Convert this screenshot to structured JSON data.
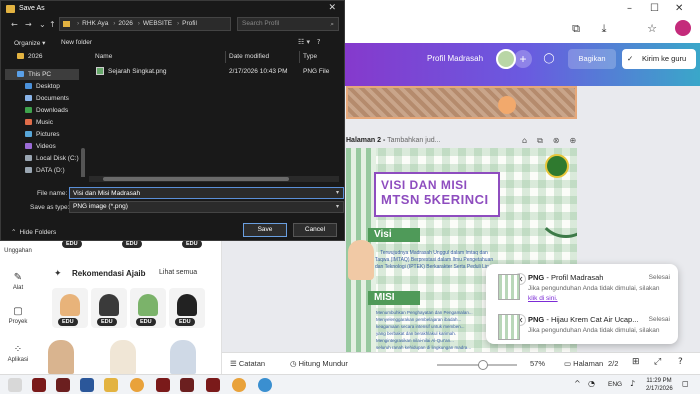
{
  "dialog": {
    "title": "Save As",
    "address": [
      "RHK Aya",
      "2026",
      "WEBSITE",
      "Profil"
    ],
    "search_placeholder": "Search Profil",
    "organize": "Organize ▾",
    "new_folder": "New folder",
    "nav_items": [
      "2026",
      "This PC",
      "Desktop",
      "Documents",
      "Downloads",
      "Music",
      "Pictures",
      "Videos",
      "Local Disk (C:)",
      "DATA (D:)"
    ],
    "columns": {
      "name": "Name",
      "date": "Date modified",
      "type": "Type"
    },
    "files": [
      {
        "name": "Sejarah Singkat.png",
        "date": "2/17/2026 10:43 PM",
        "type": "PNG File"
      }
    ],
    "file_name_label": "File name:",
    "file_name_value": "Visi dan Misi Madrasah",
    "save_type_label": "Save as type:",
    "save_type_value": "PNG image (*.png)",
    "hide_folders": "Hide Folders",
    "save": "Save",
    "cancel": "Cancel"
  },
  "canva": {
    "project_title": "Profil Madrasah",
    "share": "Bagikan",
    "send": "Kirim ke guru",
    "page2_label": "Halaman 2 -",
    "page2_hint": "Tambahkan jud...",
    "design": {
      "title_line1": "VISI DAN MISI",
      "title_line2": "MTSN 5KERINCI",
      "visi_heading": "Visi",
      "visi_text": "Terwujudnya Madrasah Unggul dalam Imtaq dan Taqwa (IMTAQ) Berprestasi dalam Ilmu Pengetahuan dan Teknologi (IPTEK) Berkarakter Serta Peduli Lin...",
      "misi_heading": "MISI",
      "misi_lines": [
        "Menumbuhkan Penghayatan dan Pengamalan...",
        "Menyelenggarakan pembelajaran ibadah...",
        "keagamaan secara intensif untuk memben...",
        "yang berbakat dan berakhlakul karimah.",
        "Mengintegrasikan nilai-nilai Al-Qur'an...",
        "seluruh ranah kehidupan di lingkungan madra..."
      ]
    },
    "bottom": {
      "notes": "Catatan",
      "timer": "Hitung Mundur",
      "zoom": "57%",
      "zoom_level": 0.57,
      "pages": "Halaman",
      "page_count": "2/2"
    },
    "rail": [
      "Unggahan",
      "Alat",
      "Proyek",
      "Aplikasi"
    ],
    "panel": {
      "edu": "EDU",
      "rec_title": "Rekomendasi Ajaib",
      "see_all": "Lihat semua"
    }
  },
  "notifications": [
    {
      "file": "PNG",
      "name": "- Profil Madrasah",
      "status": "Selesai",
      "body": "Jika pengunduhan Anda tidak dimulai, silakan",
      "link": "klik di sini."
    },
    {
      "file": "PNG",
      "name": "- Hijau Krem Cat Air Ucap...",
      "status": "Selesai",
      "body": "Jika pengunduhan Anda tidak dimulai, silakan"
    }
  ],
  "taskbar": {
    "lang": "ENG",
    "time": "11:29 PM",
    "date": "2/17/2026"
  },
  "colors": {
    "canva_purple": "#7c2bd6",
    "accent_green": "#4f9a59",
    "title_purple": "#8e4dbf"
  }
}
